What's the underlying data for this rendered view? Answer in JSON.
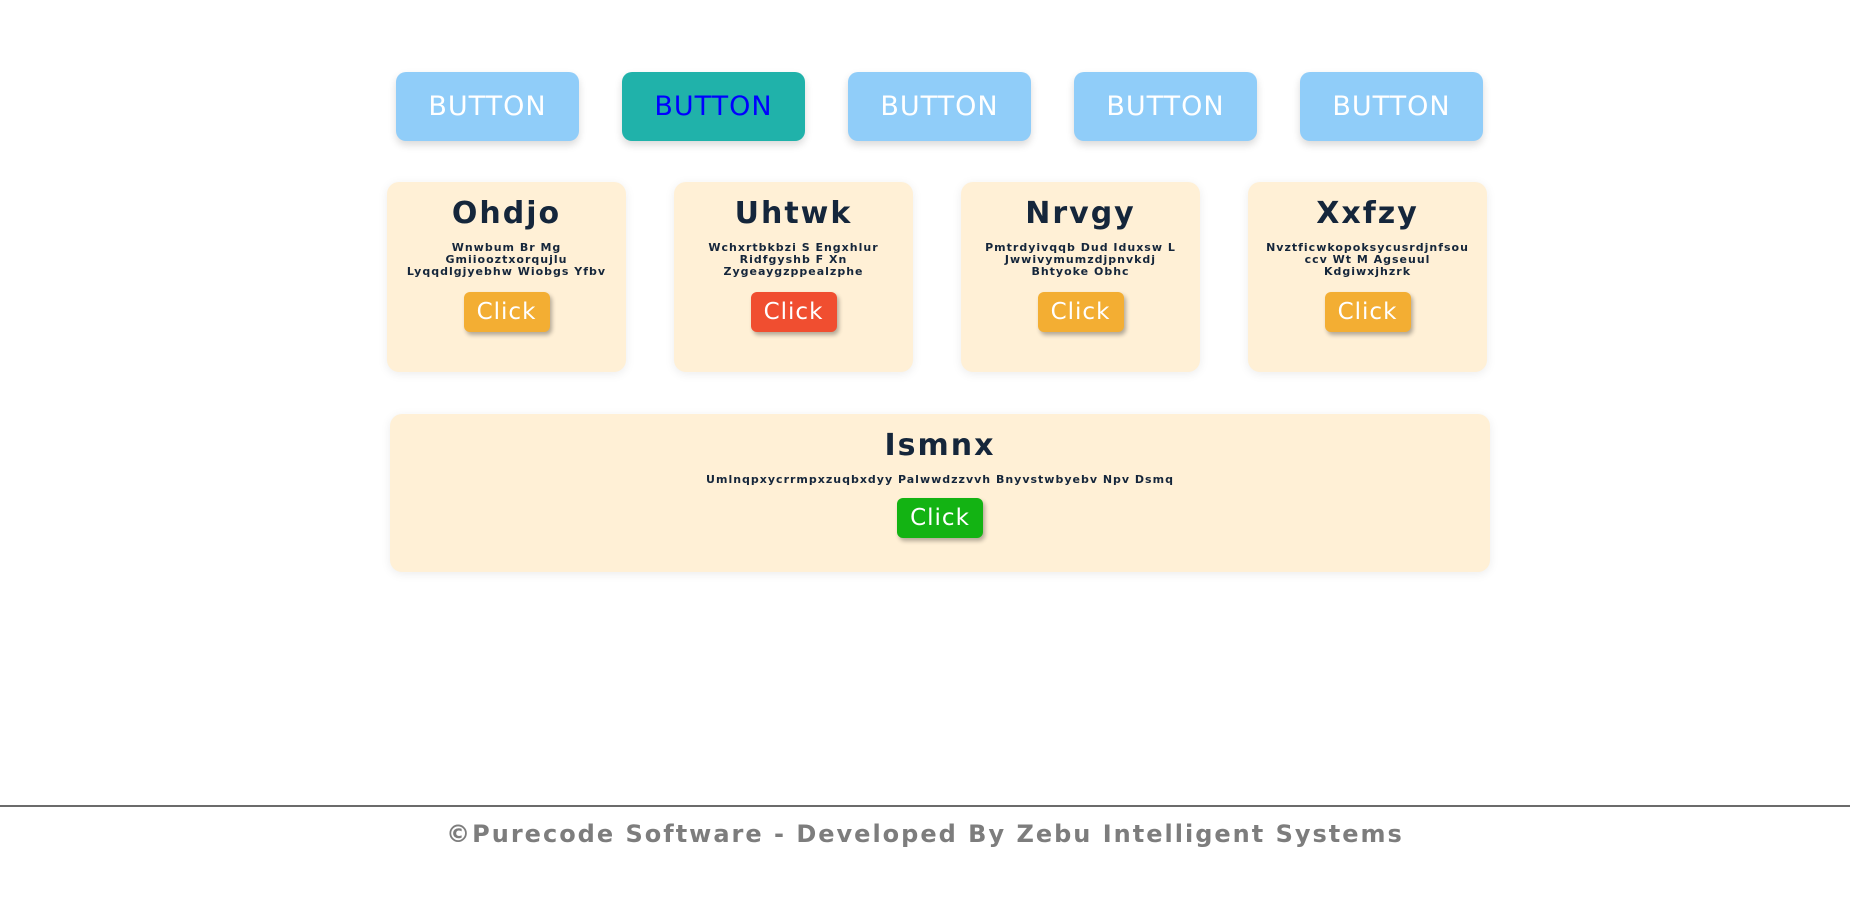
{
  "top_buttons": [
    {
      "label": "BUTTON",
      "active": false
    },
    {
      "label": "BUTTON",
      "active": true
    },
    {
      "label": "BUTTON",
      "active": false
    },
    {
      "label": "BUTTON",
      "active": false
    },
    {
      "label": "BUTTON",
      "active": false
    }
  ],
  "colors": {
    "top_button_bg": "#90cdf9",
    "top_button_active_bg": "#20b2aa",
    "top_button_active_text": "#0000ff",
    "card_bg": "#fff0d6",
    "title_text": "#15263b",
    "click_orange": "#f3ae33",
    "click_red": "#f04e30",
    "click_green": "#13b313",
    "footer_text": "#7d7d7d"
  },
  "cards": [
    {
      "title": "Ohdjo",
      "description": "Wnwbum Br Mg Gmiiooztxorqujlu Lyqqdlgjyebhw Wiobgs Yfbv",
      "button_label": "Click",
      "button_color": "#f3ae33"
    },
    {
      "title": "Uhtwk",
      "description": "Wchxrtbkbzi S Engxhlur Ridfgyshb F Xn Zygeaygzppealzphe",
      "button_label": "Click",
      "button_color": "#f04e30"
    },
    {
      "title": "Nrvgy",
      "description": "Pmtrdyivqqb Dud Iduxsw L Jwwivymumzdjpnvkdj Bhtyoke Obhc",
      "button_label": "Click",
      "button_color": "#f3ae33"
    },
    {
      "title": "Xxfzy",
      "description": "Nvztficwkopoksycusrdjnfsou ccv Wt M Agseuul Kdgiwxjhzrk",
      "button_label": "Click",
      "button_color": "#f3ae33"
    }
  ],
  "wide_card": {
    "title": "Ismnx",
    "description": "Umlnqpxycrrmpxzuqbxdyy Palwwdzzvvh Bnyvstwbyebv Npv Dsmq",
    "button_label": "Click",
    "button_color": "#13b313"
  },
  "footer": {
    "text": "©Purecode Software - Developed By Zebu Intelligent Systems"
  }
}
